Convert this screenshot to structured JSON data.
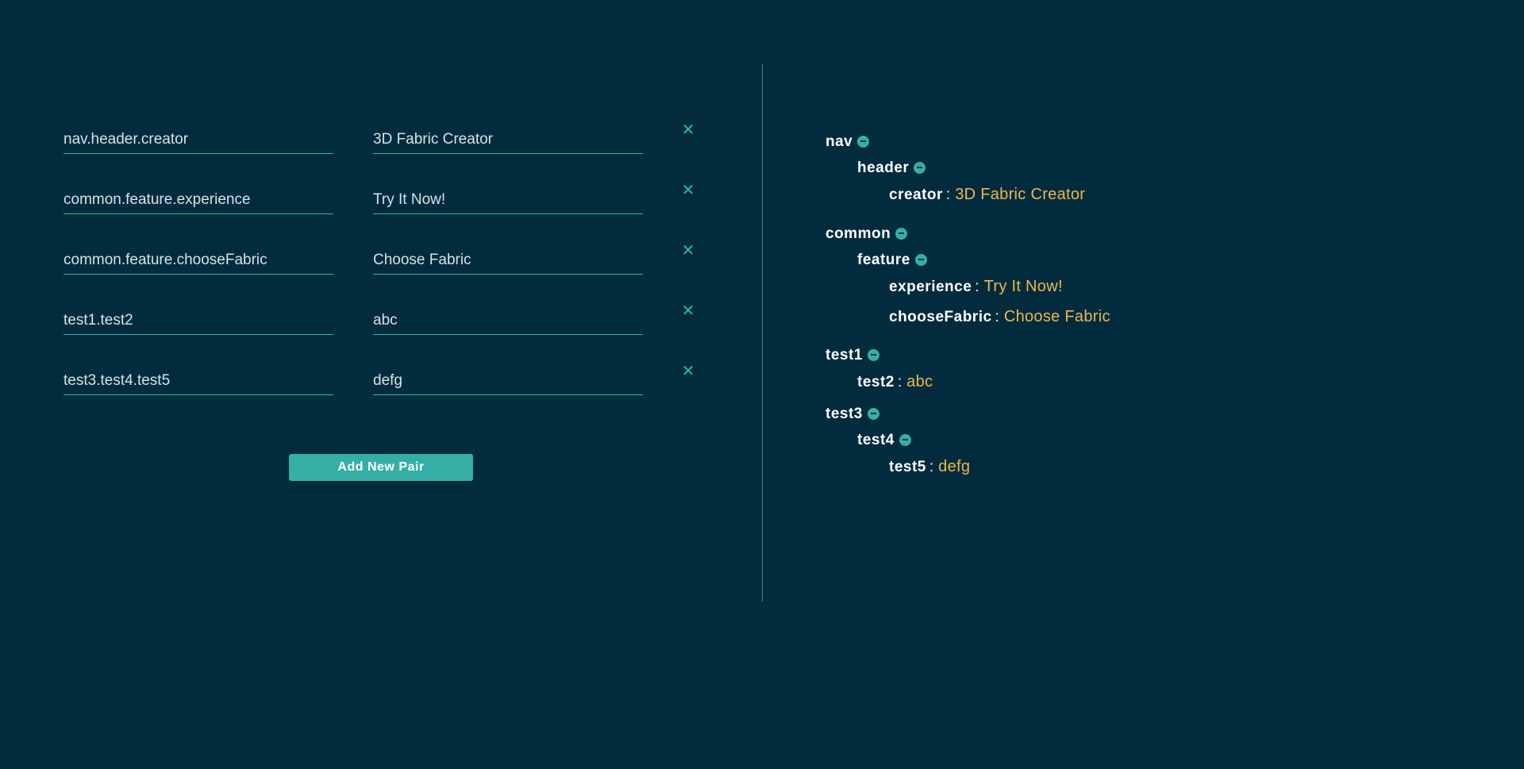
{
  "pairs": [
    {
      "key": "nav.header.creator",
      "value": "3D Fabric Creator"
    },
    {
      "key": "common.feature.experience",
      "value": "Try It Now!"
    },
    {
      "key": "common.feature.chooseFabric",
      "value": "Choose Fabric"
    },
    {
      "key": "test1.test2",
      "value": "abc"
    },
    {
      "key": "test3.test4.test5",
      "value": "defg"
    }
  ],
  "remove_glyph": "✕",
  "add_button_label": "Add New Pair",
  "tree": {
    "nav": "nav",
    "header": "header",
    "creator": "creator",
    "creator_value": "3D Fabric Creator",
    "common": "common",
    "feature": "feature",
    "experience": "experience",
    "experience_value": "Try It Now!",
    "chooseFabric": "chooseFabric",
    "chooseFabric_value": "Choose Fabric",
    "test1": "test1",
    "test2": "test2",
    "test2_value": "abc",
    "test3": "test3",
    "test4": "test4",
    "test5": "test5",
    "test5_value": "defg",
    "separator": ":"
  },
  "colors": {
    "background": "#022c3e",
    "accent": "#35afa6",
    "value_text": "#f0b54e",
    "label_text": "#ffffff"
  }
}
